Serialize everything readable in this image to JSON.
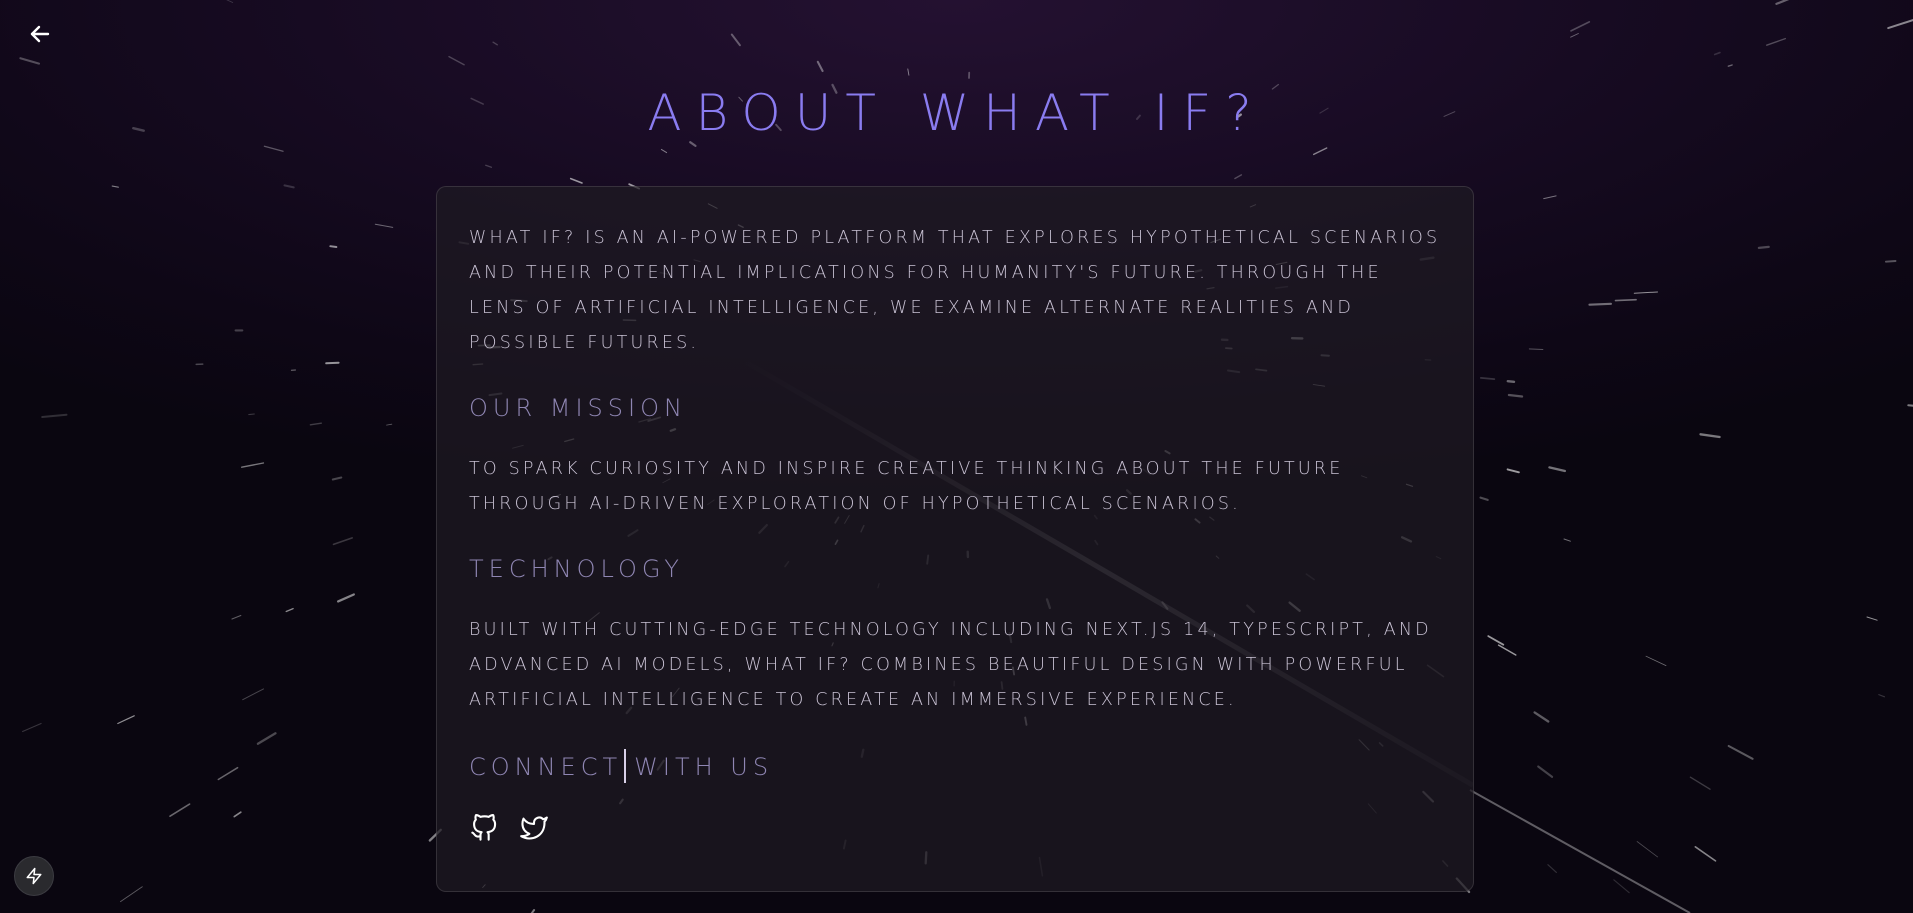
{
  "header": {
    "back_icon": "arrow-left-icon",
    "title": "ABOUT WHAT IF?"
  },
  "card": {
    "intro": "WHAT IF? IS AN AI-POWERED PLATFORM THAT EXPLORES HYPOTHETICAL SCENARIOS AND THEIR POTENTIAL IMPLICATIONS FOR HUMANITY'S FUTURE. THROUGH THE LENS OF ARTIFICIAL INTELLIGENCE, WE EXAMINE ALTERNATE REALITIES AND POSSIBLE FUTURES.",
    "mission_heading": "OUR MISSION",
    "mission_text": "TO SPARK CURIOSITY AND INSPIRE CREATIVE THINKING ABOUT THE FUTURE THROUGH AI-DRIVEN EXPLORATION OF HYPOTHETICAL SCENARIOS.",
    "technology_heading": "TECHNOLOGY",
    "technology_text": "BUILT WITH CUTTING-EDGE TECHNOLOGY INCLUDING NEXT.JS 14, TYPESCRIPT, AND ADVANCED AI MODELS, WHAT IF? COMBINES BEAUTIFUL DESIGN WITH POWERFUL ARTIFICIAL INTELLIGENCE TO CREATE AN IMMERSIVE EXPERIENCE.",
    "connect_heading_part1": "CONNECT",
    "connect_heading_part2": "WITH US",
    "social": [
      {
        "icon": "github-icon"
      },
      {
        "icon": "twitter-icon"
      }
    ]
  },
  "fab": {
    "icon": "lightning-bolt-icon"
  },
  "colors": {
    "title": "#8a7cf0",
    "heading": "#8f86b3",
    "body_text": "#c9c2d4",
    "background": "#170b22"
  }
}
